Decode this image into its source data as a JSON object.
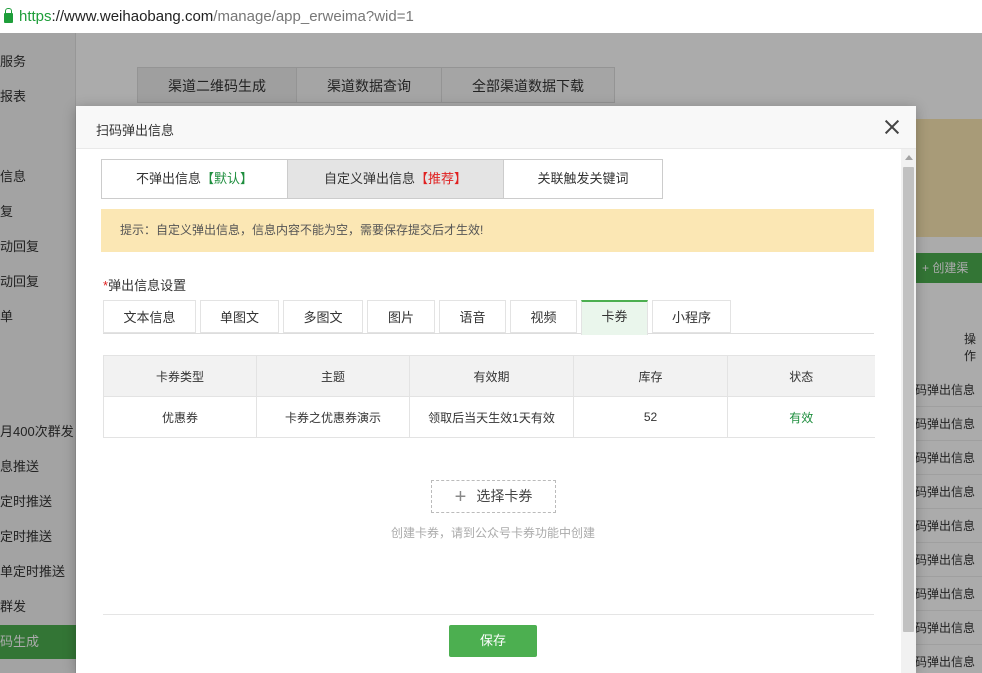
{
  "browser": {
    "url_scheme": "https",
    "url_host": "://www.weihaobang.com",
    "url_path": "/manage/app_erweima?wid=1"
  },
  "background": {
    "sidebar_items": [
      "服务",
      "报表",
      "",
      "信息",
      "复",
      "动回复",
      "动回复",
      "单",
      "",
      "",
      "月400次群发",
      "息推送",
      "定时推送",
      "定时推送",
      "单定时推送",
      "群发",
      "码生成"
    ],
    "top_tabs": [
      "渠道二维码生成",
      "渠道数据查询",
      "全部渠道数据下载"
    ],
    "create_button": "+ 创建渠",
    "op_header": "操作",
    "op_links": [
      "码弹出信息",
      "码弹出信息",
      "码弹出信息",
      "码弹出信息",
      "码弹出信息",
      "码弹出信息",
      "码弹出信息",
      "码弹出信息",
      "码弹出信息"
    ]
  },
  "modal": {
    "title": "扫码弹出信息",
    "mode_tabs": [
      {
        "label": "不弹出信息",
        "tag": "【默认】"
      },
      {
        "label": "自定义弹出信息",
        "tag": "【推荐】"
      },
      {
        "label": "关联触发关键词",
        "tag": ""
      }
    ],
    "tip": "提示：自定义弹出信息，信息内容不能为空，需要保存提交后才生效!",
    "section_required_mark": "*",
    "section_label": "弹出信息设置",
    "type_tabs": [
      "文本信息",
      "单图文",
      "多图文",
      "图片",
      "语音",
      "视频",
      "卡券",
      "小程序"
    ],
    "active_type": "卡券",
    "table": {
      "headers": [
        "卡券类型",
        "主题",
        "有效期",
        "库存",
        "状态"
      ],
      "rows": [
        [
          "优惠券",
          "卡券之优惠券演示",
          "领取后当天生效1天有效",
          "52",
          "有效"
        ]
      ]
    },
    "select_button": "选择卡券",
    "hint": "创建卡券，请到公众号卡券功能中创建",
    "save_button": "保存"
  }
}
